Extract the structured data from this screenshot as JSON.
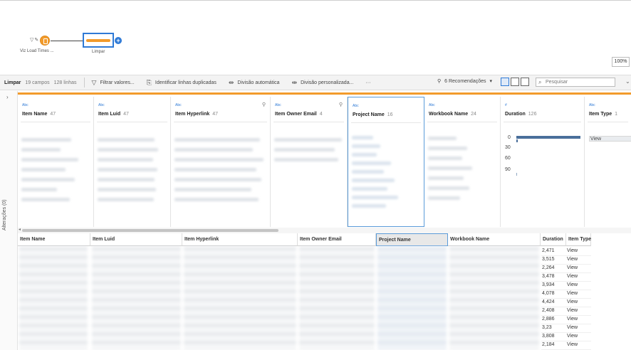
{
  "flow": {
    "input_node_label": "Viz Load Times ...",
    "clean_node_label": "Limpar",
    "zoom": "100%"
  },
  "toolbar": {
    "title": "Limpar",
    "fields": "19 campos",
    "rows": "128 linhas",
    "filter": "Filtrar valores...",
    "duplicates": "Identificar linhas duplicadas",
    "auto_split": "Divisão automática",
    "custom_split": "Divisão personalizada...",
    "more": "···",
    "recommendations": "6 Recomendações",
    "search_placeholder": "Pesquisar"
  },
  "changes_panel": {
    "label": "Alterações (0)"
  },
  "profile_cards": [
    {
      "type": "Abc",
      "name": "Item Name",
      "count": "47"
    },
    {
      "type": "Abc",
      "name": "Item Luid",
      "count": "47"
    },
    {
      "type": "Abc",
      "name": "Item Hyperlink",
      "count": "47"
    },
    {
      "type": "Abc",
      "name": "Item Owner Email",
      "count": "4"
    },
    {
      "type": "Abc",
      "name": "Project Name",
      "count": "16"
    },
    {
      "type": "Abc",
      "name": "Workbook Name",
      "count": "24"
    },
    {
      "type": "#",
      "name": "Duration",
      "count": "126"
    },
    {
      "type": "Abc",
      "name": "Item Type",
      "count": "1"
    }
  ],
  "duration_profile": {
    "ticks": [
      "0",
      "30",
      "60",
      "90"
    ],
    "first_bin_share": 1.0
  },
  "item_type_values": [
    "View"
  ],
  "table": {
    "headers": [
      "Item Name",
      "Item Luid",
      "Item Hyperlink",
      "Item Owner Email",
      "Project Name",
      "Workbook Name",
      "Duration",
      "Item Type"
    ],
    "rows": [
      {
        "duration": "2,471",
        "item_type": "View"
      },
      {
        "duration": "3,515",
        "item_type": "View"
      },
      {
        "duration": "2,264",
        "item_type": "View"
      },
      {
        "duration": "3,478",
        "item_type": "View"
      },
      {
        "duration": "3,934",
        "item_type": "View"
      },
      {
        "duration": "4,078",
        "item_type": "View"
      },
      {
        "duration": "4,424",
        "item_type": "View"
      },
      {
        "duration": "2,408",
        "item_type": "View"
      },
      {
        "duration": "2,886",
        "item_type": "View"
      },
      {
        "duration": "3,23",
        "item_type": "View"
      },
      {
        "duration": "3,808",
        "item_type": "View"
      },
      {
        "duration": "2,184",
        "item_type": "View"
      }
    ]
  }
}
